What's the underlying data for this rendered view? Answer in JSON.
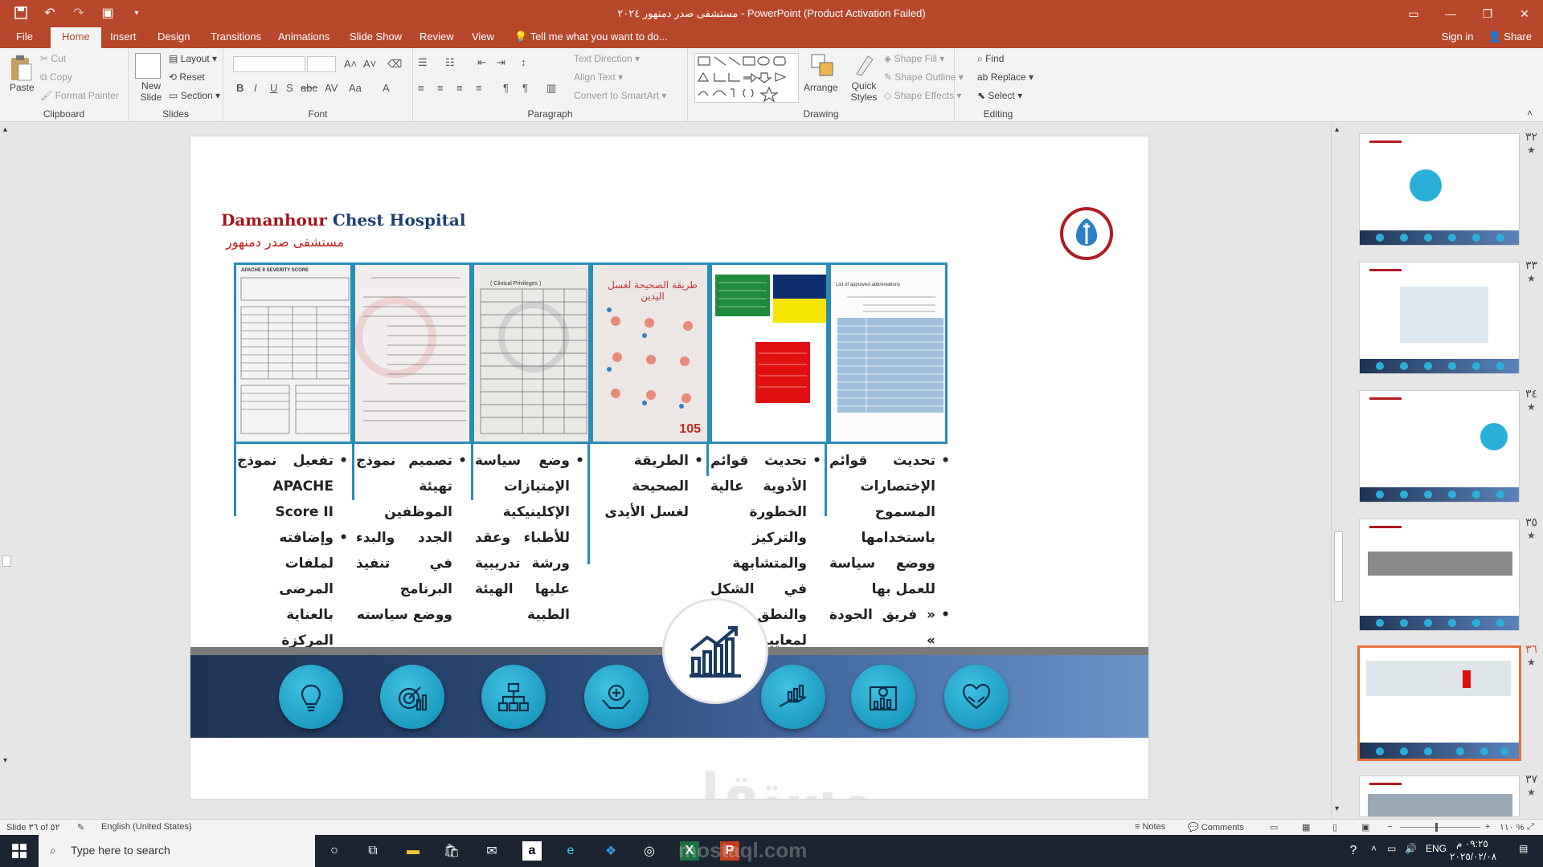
{
  "window": {
    "title": "مستشفى صدر دمنهور ٢٠٢٤ - PowerPoint (Product Activation Failed)",
    "sign_in": "Sign in",
    "share": "Share"
  },
  "tabs": [
    "File",
    "Home",
    "Insert",
    "Design",
    "Transitions",
    "Animations",
    "Slide Show",
    "Review",
    "View"
  ],
  "tell_me": "Tell me what you want to do...",
  "ribbon": {
    "clipboard": {
      "label": "Clipboard",
      "paste": "Paste",
      "cut": "Cut",
      "copy": "Copy",
      "format_painter": "Format Painter"
    },
    "slides": {
      "label": "Slides",
      "new_slide": "New Slide",
      "layout": "Layout",
      "reset": "Reset",
      "section": "Section"
    },
    "font": {
      "label": "Font"
    },
    "paragraph": {
      "label": "Paragraph",
      "text_direction": "Text Direction",
      "align_text": "Align Text",
      "convert_smartart": "Convert to SmartArt"
    },
    "drawing": {
      "label": "Drawing",
      "arrange": "Arrange",
      "quick_styles": "Quick Styles",
      "shape_fill": "Shape Fill",
      "shape_outline": "Shape Outline",
      "shape_effects": "Shape Effects"
    },
    "editing": {
      "label": "Editing",
      "find": "Find",
      "replace": "Replace",
      "select": "Select"
    }
  },
  "slide": {
    "hospital_en_1": "Damanhour",
    "hospital_en_2": "Chest Hospital",
    "hospital_ar": "مستشفى صدر دمنهور",
    "doc_labels": {
      "apache": "APACHE II SEVERITY SCORE",
      "clinical": "( Clinical Privileges )",
      "handwash": "طريقة الصحيحة لغسل اليدين",
      "handwash_num": "105",
      "abbr": "List of approved abbreviations"
    },
    "columns": [
      {
        "items": [
          "تفعيل نموذج APACHE Score II",
          "وإضافته لملفات المرضى بالعناية المركزة"
        ]
      },
      {
        "items": [
          "تصميم نموذج تهيئة الموظفين الجدد والبدء في تنفيذ البرنامج ووضع سياسته"
        ]
      },
      {
        "items": [
          "وضع سياسة الإمتيازات الإكلينيكية للأطباء وعقد ورشة تدريبية عليها الهيئة الطبية"
        ]
      },
      {
        "items": [
          "الطريقة الصحيحة لغسل الأيدى"
        ]
      },
      {
        "items": [
          "تحديث قوائم الأدوية عالية الخطورة والتركيز والمتشابهة في الشكل والنطق وفقا لمعايير سلامة المريض"
        ]
      },
      {
        "items": [
          "تحديث قوائم الإختصارات المسموح باستخدامها ووضع سياسة للعمل بها",
          "« فريق الجودة »"
        ]
      }
    ],
    "watermark": "مستقل"
  },
  "thumbnails": [
    {
      "num": "٣٢"
    },
    {
      "num": "٣٣"
    },
    {
      "num": "٣٤"
    },
    {
      "num": "٣٥"
    },
    {
      "num": "٣٦"
    },
    {
      "num": "٣٧"
    }
  ],
  "status": {
    "slide": "Slide ٣٦ of ٥٢",
    "language": "English (United States)",
    "notes": "Notes",
    "comments": "Comments",
    "zoom": "١١٠ %"
  },
  "taskbar": {
    "search": "Type here to search",
    "lang": "ENG",
    "time": "٠٩:٢٥ م",
    "date": "٢٠٢٥/٠٢/٠٨",
    "site": "mostaql.com"
  },
  "colors": {
    "accent": "#b7472a",
    "slide_border": "#2a8db4",
    "nav_dark": "#1e3354",
    "circle": "#1aa6cf"
  }
}
